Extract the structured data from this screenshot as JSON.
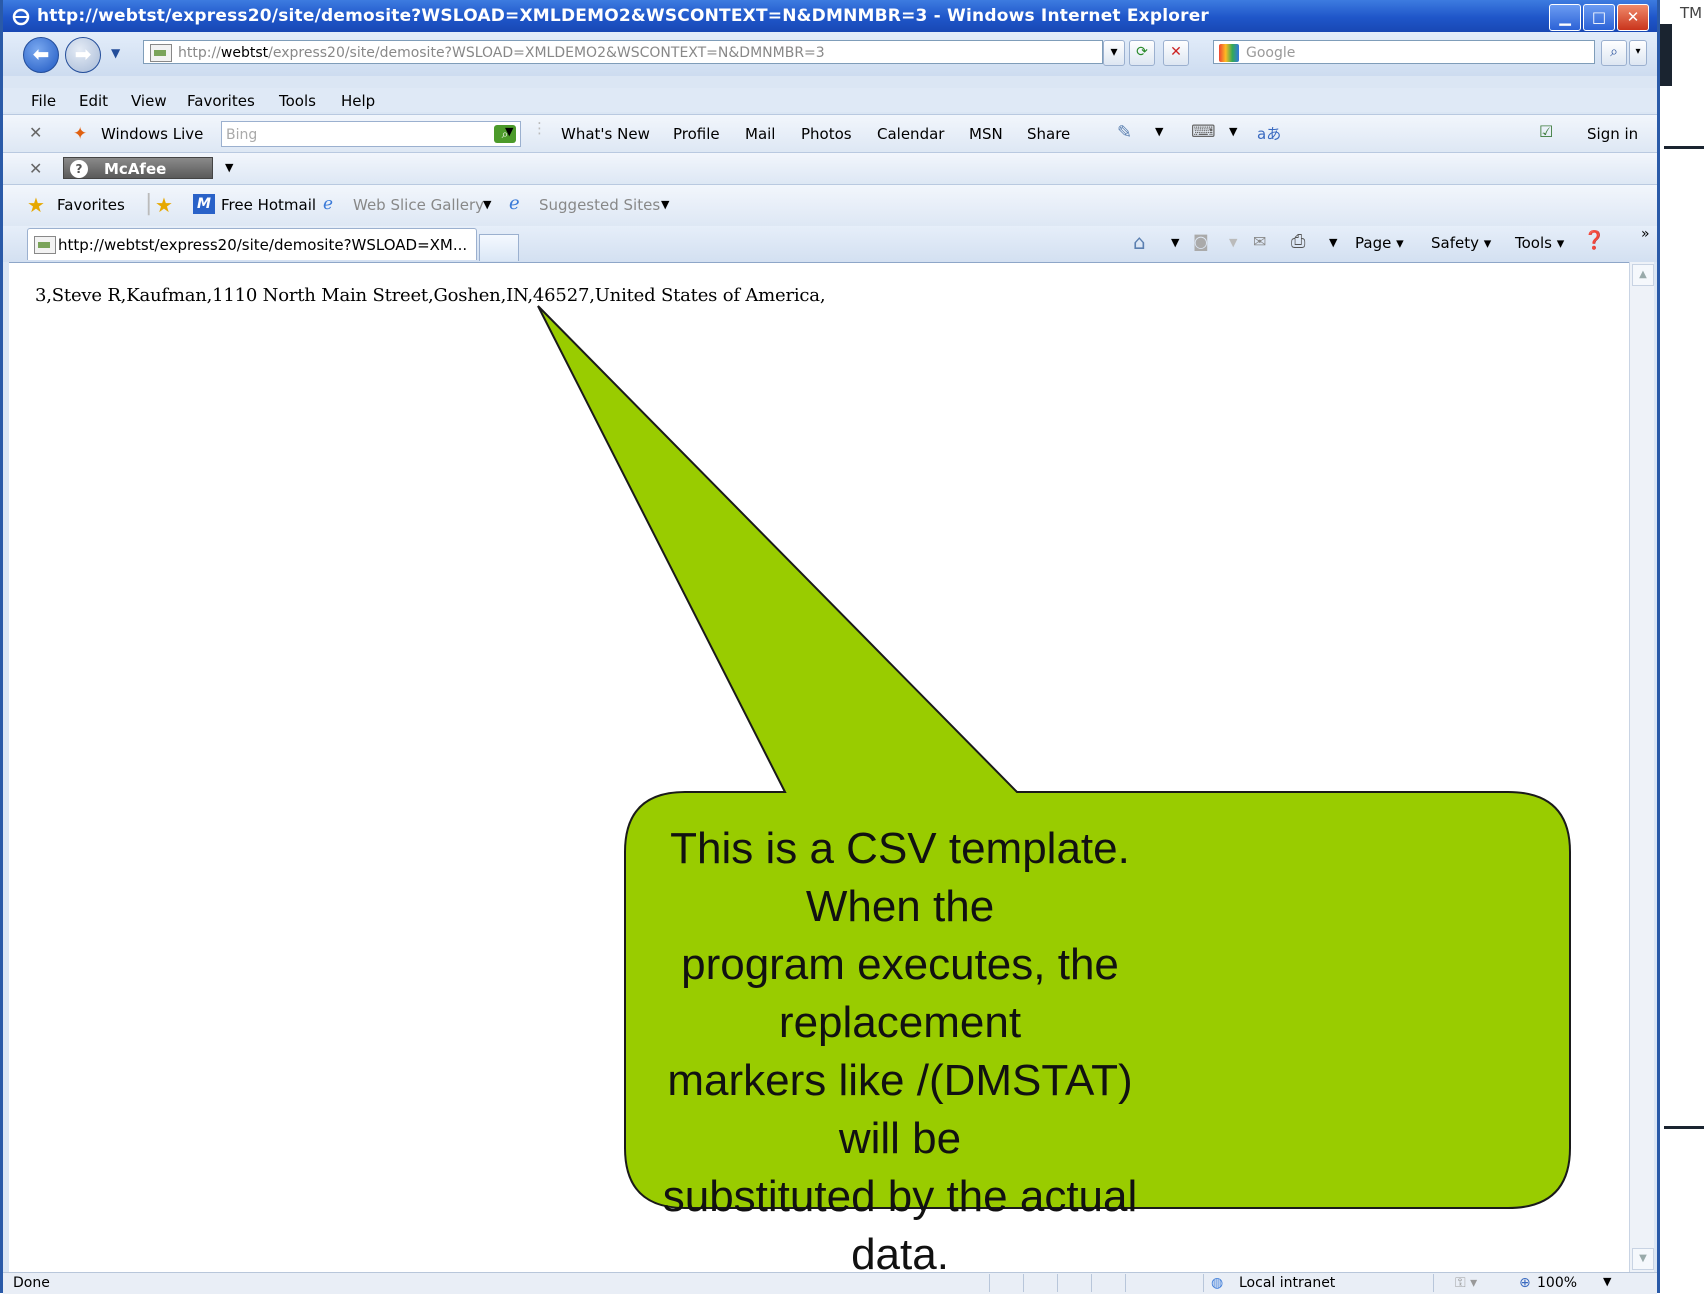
{
  "window": {
    "title": "http://webtst/express20/site/demosite?WSLOAD=XMLDEMO2&WSCONTEXT=N&DMNMBR=3 - Windows Internet Explorer",
    "minimize": "▁",
    "maximize": "□",
    "close": "✕"
  },
  "slide": {
    "tm": "TM"
  },
  "address_bar": {
    "url_prefix": "http://",
    "url_host": "webtst",
    "url_path": "/express20/site/demosite?WSLOAD=XMLDEMO2&WSCONTEXT=N&DMNMBR=3",
    "search_placeholder": "Google"
  },
  "menu": [
    "File",
    "Edit",
    "View",
    "Favorites",
    "Tools",
    "Help"
  ],
  "live_toolbar": {
    "brand": "Windows Live",
    "search_placeholder": "Bing",
    "links": [
      "What's New",
      "Profile",
      "Mail",
      "Photos",
      "Calendar",
      "MSN",
      "Share"
    ],
    "sign_in": "Sign in"
  },
  "mcafee_toolbar": {
    "label": "McAfee"
  },
  "favorites_bar": {
    "favorites": "Favorites",
    "items": [
      "Free Hotmail",
      "Web Slice Gallery",
      "Suggested Sites"
    ]
  },
  "tab": {
    "label": "http://webtst/express20/site/demosite?WSLOAD=XM..."
  },
  "command_bar": [
    "Page",
    "Safety",
    "Tools"
  ],
  "content": {
    "csv_line": "3,Steve R,Kaufman,1110 North Main Street,Goshen,IN,46527,United States of America,"
  },
  "callout": {
    "text_lines": [
      "This is a CSV template. When the",
      "program executes, the replacement",
      "markers like /(DMSTAT) will be",
      "substituted by the actual data."
    ],
    "fill": "#99cc00",
    "stroke": "#1a1a1a"
  },
  "status_bar": {
    "status": "Done",
    "zone": "Local intranet",
    "zoom": "100%"
  }
}
